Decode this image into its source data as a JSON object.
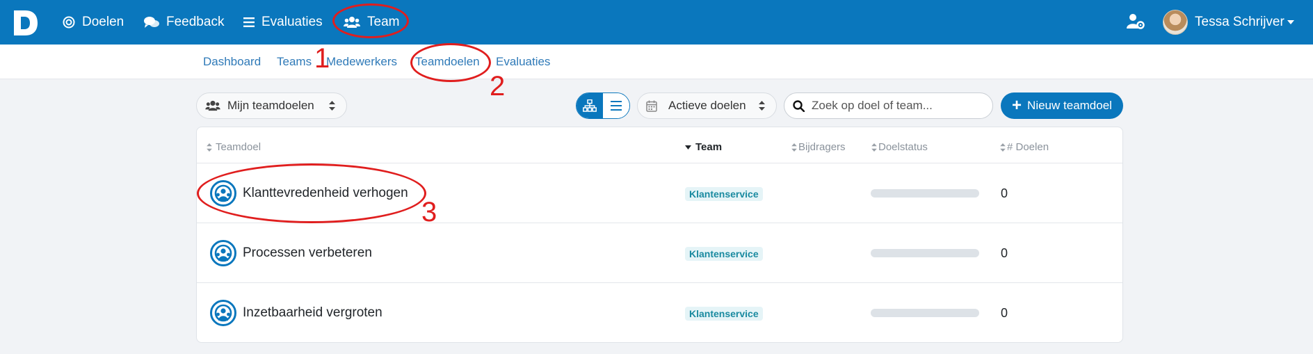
{
  "navbar": {
    "logo": "D",
    "items": [
      {
        "label": "Doelen",
        "icon": "target-icon"
      },
      {
        "label": "Feedback",
        "icon": "comments-icon"
      },
      {
        "label": "Evaluaties",
        "icon": "list-icon"
      },
      {
        "label": "Team",
        "icon": "users-icon"
      }
    ],
    "user_name": "Tessa Schrijver"
  },
  "subnav": {
    "items": [
      "Dashboard",
      "Teams",
      "Medewerkers",
      "Teamdoelen",
      "Evaluaties"
    ]
  },
  "toolbar": {
    "filter_label": "Mijn teamdoelen",
    "status_label": "Actieve doelen",
    "search_placeholder": "Zoek op doel of team...",
    "new_button_label": "Nieuw teamdoel"
  },
  "table": {
    "headers": [
      "Teamdoel",
      "Team",
      "Bijdragers",
      "Doelstatus",
      "# Doelen"
    ],
    "rows": [
      {
        "name": "Klanttevredenheid verhogen",
        "team": "Klantenservice",
        "progress": 0,
        "count": "0"
      },
      {
        "name": "Processen verbeteren",
        "team": "Klantenservice",
        "progress": 0,
        "count": "0"
      },
      {
        "name": "Inzetbaarheid vergroten",
        "team": "Klantenservice",
        "progress": 0,
        "count": "0"
      }
    ]
  },
  "annotations": [
    "1",
    "2",
    "3"
  ],
  "colors": {
    "primary": "#0a77bd",
    "annotation": "#e01e1e",
    "badge_bg": "#e5f4f7",
    "badge_text": "#1a8aa0"
  }
}
